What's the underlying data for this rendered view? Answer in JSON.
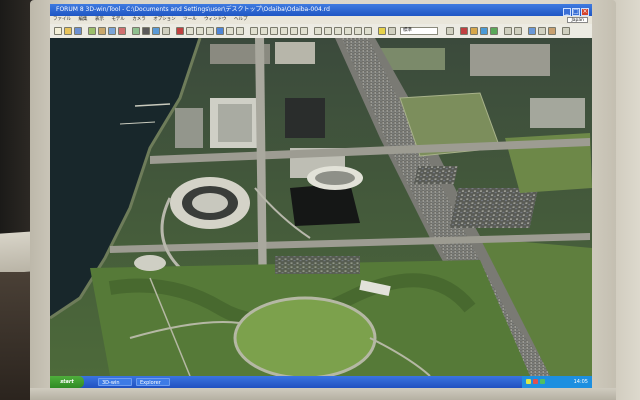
{
  "photo": {
    "subject": "LCD monitor displaying a 3D aerial map viewer application"
  },
  "window": {
    "title": "FORUM 8   3D-win/Tool  -  C:\\Documents and Settings\\user\\デスクトップ\\Odaiba\\Odaiba-004.rd",
    "buttons": [
      "minimize-icon",
      "maximize-icon",
      "close-icon"
    ]
  },
  "menu": {
    "items": [
      "ファイル",
      "編集",
      "表示",
      "モデル",
      "カメラ",
      "オプション",
      "ツール",
      "ウィンドウ",
      "ヘルプ"
    ],
    "language": "Japan"
  },
  "toolbar": {
    "select_value": "標準"
  },
  "taskbar": {
    "start_label": "start",
    "tasks": [
      "3D-win",
      "Explorer"
    ],
    "clock": "14:05"
  },
  "colors": {
    "titlebar": "#2a62d0",
    "water": "#1a2a2f",
    "park_green": "#5f8a3e",
    "highway": "#8c8c88"
  }
}
